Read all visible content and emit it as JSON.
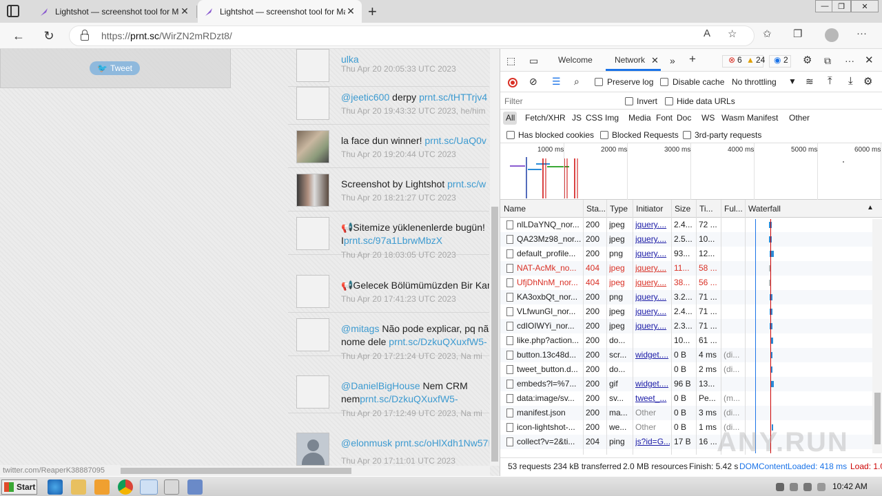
{
  "browser": {
    "tabs": [
      {
        "title": "Lightshot — screenshot tool for Ma"
      },
      {
        "title": "Lightshot — screenshot tool for Ma"
      }
    ],
    "url_prefix": "https://",
    "url_host": "prnt.sc",
    "url_path": "/WirZN2mRDzt8/",
    "zoom_icon": "read-aloud-icon"
  },
  "page": {
    "truncated_top": "ulka",
    "tweet_label": "Tweet",
    "status_url": "twitter.com/ReaperK38887095",
    "feed": [
      {
        "user": "",
        "text": "",
        "link": "ulka",
        "time": "Thu Apr 20 20:05:33 UTC 2023"
      },
      {
        "user": "@jeetic600",
        "text": " derpy ",
        "link": "prnt.sc/tHTTrjv4",
        "time": "Thu Apr 20 19:43:32 UTC 2023, he/him"
      },
      {
        "user": "",
        "text": "la face dun winner! ",
        "link": "prnt.sc/UaQ0v",
        "time": "Thu Apr 20 19:20:44 UTC 2023"
      },
      {
        "user": "",
        "text": "Screenshot by Lightshot ",
        "link": "prnt.sc/w",
        "time": "Thu Apr 20 18:21:27 UTC 2023"
      },
      {
        "user": "",
        "text": "📢Sitemize yüklenenlerde bugün! I",
        "link": "prnt.sc/97a1LbrwMbzX",
        "time": "Thu Apr 20 18:03:05 UTC 2023"
      },
      {
        "user": "",
        "text": "📢Gelecek Bölümümüzden Bir Kar",
        "link": "",
        "time": "Thu Apr 20 17:41:23 UTC 2023"
      },
      {
        "user": "@mitags",
        "text": " Não pode explicar, pq nã nome dele ",
        "link": "prnt.sc/DzkuQXuxfW5-",
        "time": "Thu Apr 20 17:21:24 UTC 2023, Na mi"
      },
      {
        "user": "@DanielBigHouse",
        "text": " Nem CRM nem",
        "link": "prnt.sc/DzkuQXuxfW5-",
        "time": "Thu Apr 20 17:12:49 UTC 2023, Na mi"
      },
      {
        "user": "@elonmusk",
        "text": " ",
        "link": "prnt.sc/oHlXdh1Nw57I",
        "time": "Thu Apr 20 17:11:01 UTC 2023"
      }
    ]
  },
  "devtools": {
    "tabs": [
      "Welcome",
      "Network"
    ],
    "errors": "6",
    "warnings": "24",
    "issues": "2",
    "toolbar": {
      "preserve_log": "Preserve log",
      "disable_cache": "Disable cache",
      "throttling": "No throttling"
    },
    "filter_placeholder": "Filter",
    "invert": "Invert",
    "hide_data_urls": "Hide data URLs",
    "types": [
      "All",
      "Fetch/XHR",
      "JS",
      "CSS",
      "Img",
      "Media",
      "Font",
      "Doc",
      "WS",
      "Wasm",
      "Manifest",
      "Other"
    ],
    "blocked_cookies": "Has blocked cookies",
    "blocked_requests": "Blocked Requests",
    "third_party": "3rd-party requests",
    "overview_ticks": [
      "1000 ms",
      "2000 ms",
      "3000 ms",
      "4000 ms",
      "5000 ms",
      "6000 ms"
    ],
    "columns": [
      "Name",
      "Sta...",
      "Type",
      "Initiator",
      "Size",
      "Ti...",
      "Ful...",
      "Waterfall"
    ],
    "rows": [
      {
        "name": "nlLDaYNQ_nor...",
        "status": "200",
        "type": "jpeg",
        "initiator": "jquery....",
        "size": "2.4...",
        "time": "72 ...",
        "full": "",
        "error": false,
        "wf_start": 0.35,
        "wf_len": 0.02
      },
      {
        "name": "QA23Mz98_nor...",
        "status": "200",
        "type": "jpeg",
        "initiator": "jquery....",
        "size": "2.5...",
        "time": "10...",
        "full": "",
        "error": false,
        "wf_start": 0.35,
        "wf_len": 0.02
      },
      {
        "name": "default_profile...",
        "status": "200",
        "type": "png",
        "initiator": "jquery....",
        "size": "93...",
        "time": "12...",
        "full": "",
        "error": false,
        "wf_start": 0.36,
        "wf_len": 0.03
      },
      {
        "name": "NAT-AcMk_no...",
        "status": "404",
        "type": "jpeg",
        "initiator": "jquery....",
        "size": "11...",
        "time": "58 ...",
        "full": "",
        "error": true,
        "wf_start": 0.35,
        "wf_len": 0.01
      },
      {
        "name": "UfjDhNnM_nor...",
        "status": "404",
        "type": "jpeg",
        "initiator": "jquery....",
        "size": "38...",
        "time": "56 ...",
        "full": "",
        "error": true,
        "wf_start": 0.35,
        "wf_len": 0.01
      },
      {
        "name": "KA3oxbQt_nor...",
        "status": "200",
        "type": "png",
        "initiator": "jquery....",
        "size": "3.2...",
        "time": "71 ...",
        "full": "",
        "error": false,
        "wf_start": 0.36,
        "wf_len": 0.02
      },
      {
        "name": "VLfwunGl_nor...",
        "status": "200",
        "type": "jpeg",
        "initiator": "jquery....",
        "size": "2.4...",
        "time": "71 ...",
        "full": "",
        "error": false,
        "wf_start": 0.36,
        "wf_len": 0.02
      },
      {
        "name": "cdIOIWYi_nor...",
        "status": "200",
        "type": "jpeg",
        "initiator": "jquery....",
        "size": "2.3...",
        "time": "71 ...",
        "full": "",
        "error": false,
        "wf_start": 0.36,
        "wf_len": 0.02
      },
      {
        "name": "like.php?action...",
        "status": "200",
        "type": "do...",
        "initiator": "",
        "size": "10...",
        "time": "61 ...",
        "full": "",
        "error": false,
        "wf_start": 0.37,
        "wf_len": 0.02
      },
      {
        "name": "button.13c48d...",
        "status": "200",
        "type": "scr...",
        "initiator": "widget....",
        "size": "0 B",
        "time": "4 ms",
        "full": "(di...",
        "error": false,
        "wf_start": 0.38,
        "wf_len": 0.005
      },
      {
        "name": "tweet_button.d...",
        "status": "200",
        "type": "do...",
        "initiator": "",
        "size": "0 B",
        "time": "2 ms",
        "full": "(di...",
        "error": false,
        "wf_start": 0.38,
        "wf_len": 0.005
      },
      {
        "name": "embeds?l=%7...",
        "status": "200",
        "type": "gif",
        "initiator": "widget....",
        "size": "96 B",
        "time": "13...",
        "full": "",
        "error": false,
        "wf_start": 0.38,
        "wf_len": 0.02
      },
      {
        "name": "data:image/sv...",
        "status": "200",
        "type": "sv...",
        "initiator": "tweet_...",
        "size": "0 B",
        "time": "Pe...",
        "full": "(m...",
        "error": false,
        "wf_start": 0.0,
        "wf_len": 0.0
      },
      {
        "name": "manifest.json",
        "status": "200",
        "type": "ma...",
        "initiator": "Other",
        "size": "0 B",
        "time": "3 ms",
        "full": "(di...",
        "error": false,
        "wf_start": 0.0,
        "wf_len": 0.0
      },
      {
        "name": "icon-lightshot-...",
        "status": "200",
        "type": "we...",
        "initiator": "Other",
        "size": "0 B",
        "time": "1 ms",
        "full": "(di...",
        "error": false,
        "wf_start": 0.39,
        "wf_len": 0.005
      },
      {
        "name": "collect?v=2&ti...",
        "status": "204",
        "type": "ping",
        "initiator": "js?id=G...",
        "size": "17 B",
        "time": "16 ...",
        "full": "",
        "error": false,
        "wf_start": 0.0,
        "wf_len": 0.0
      }
    ],
    "status_bar": {
      "requests": "53 requests",
      "transferred": "234 kB transferred",
      "resources": "2.0 MB resources",
      "finish": "Finish: 5.42 s",
      "dcl": "DOMContentLoaded: 418 ms",
      "load": "Load: 1.0"
    }
  },
  "taskbar": {
    "start": "Start",
    "clock": "10:42 AM"
  },
  "watermark": "ANY.RUN",
  "colors": {
    "link": "#3c9ad0",
    "error": "#d93025",
    "accent": "#1a73e8"
  }
}
